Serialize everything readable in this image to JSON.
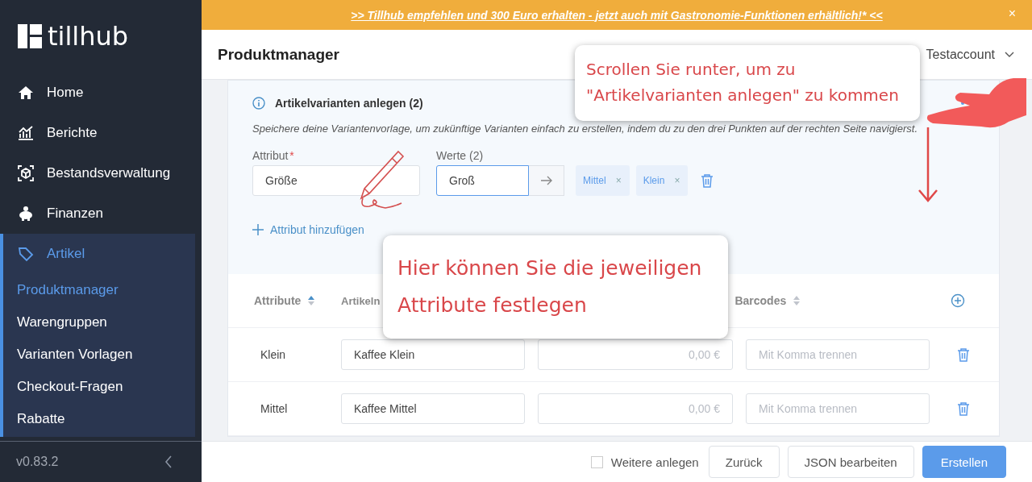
{
  "sidebar": {
    "logo": "tillhub",
    "items": [
      {
        "label": "Home",
        "selected": false,
        "expanded": false
      },
      {
        "label": "Berichte",
        "selected": false,
        "expanded": false
      },
      {
        "label": "Bestandsverwaltung",
        "selected": false,
        "expanded": false
      },
      {
        "label": "Finanzen",
        "selected": false,
        "expanded": false
      },
      {
        "label": "Artikel",
        "selected": true,
        "expanded": true,
        "children": [
          {
            "label": "Produktmanager",
            "selected": true
          },
          {
            "label": "Warengruppen",
            "selected": false
          },
          {
            "label": "Varianten Vorlagen",
            "selected": false
          },
          {
            "label": "Checkout-Fragen",
            "selected": false
          },
          {
            "label": "Rabatte",
            "selected": false
          }
        ]
      }
    ],
    "version": "v0.83.2"
  },
  "banner": {
    "text": ">> Tillhub empfehlen und 300 Euro erhalten - jetzt auch mit Gastronomie-Funktionen erhältlich!* <<",
    "close": "×"
  },
  "header": {
    "title": "Produktmanager",
    "account": "Testaccount"
  },
  "variants": {
    "title": "Artikelvarianten anlegen (2)",
    "description": "Speichere deine Variantenvorlage, um zukünftige Varianten einfach zu erstellen, indem du zu den drei Punkten auf der rechten Seite navigierst.",
    "attribute": {
      "label": "Attribut",
      "required_mark": "*",
      "value": "Größe"
    },
    "values": {
      "label": "Werte (2)",
      "value": "Groß",
      "tags": [
        {
          "label": "Mittel",
          "remove": "×"
        },
        {
          "label": "Klein",
          "remove": "×"
        }
      ]
    },
    "add_attribute": "Attribut hinzufügen"
  },
  "table": {
    "columns": [
      {
        "label": "Attribute",
        "sorted": true
      },
      {
        "label": "Artikeln"
      },
      {
        "label": "Barcodes",
        "sorted": false
      }
    ],
    "rows": [
      {
        "attribute": "Klein",
        "name": "Kaffee Klein",
        "price_placeholder": "0,00 €",
        "barcode_placeholder": "Mit Komma trennen"
      },
      {
        "attribute": "Mittel",
        "name": "Kaffee Mittel",
        "price_placeholder": "0,00 €",
        "barcode_placeholder": "Mit Komma trennen"
      }
    ]
  },
  "footer": {
    "checkbox": {
      "label": "Weitere anlegen",
      "checked": false
    },
    "buttons": [
      {
        "label": "Zurück",
        "kind": "default"
      },
      {
        "label": "JSON bearbeiten",
        "kind": "default"
      },
      {
        "label": "Erstellen",
        "kind": "primary"
      }
    ]
  },
  "callouts": [
    {
      "text": "Scrollen Sie runter, um zu\n\"Artikelvarianten anlegen\" zu kommen"
    },
    {
      "text": "Hier können Sie die jeweiligen\nAttribute festlegen"
    }
  ]
}
